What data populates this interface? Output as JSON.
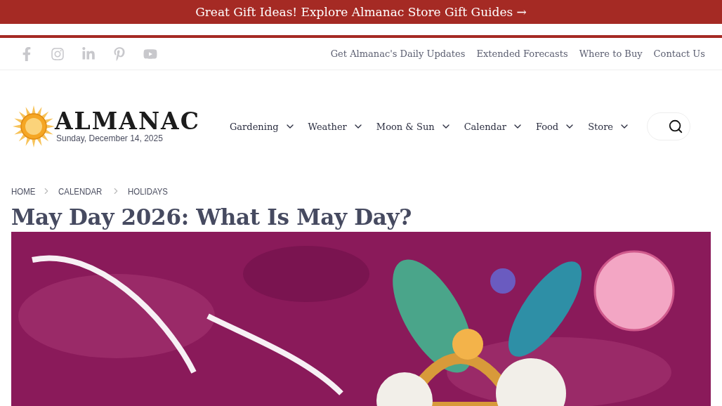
{
  "promo_banner": {
    "text": "Great Gift Ideas! Explore Almanac Store Gift Guides →"
  },
  "social_links": [
    {
      "kind": "facebook"
    },
    {
      "kind": "instagram"
    },
    {
      "kind": "linkedin"
    },
    {
      "kind": "pinterest"
    },
    {
      "kind": "youtube"
    }
  ],
  "utility_links": [
    "Get Almanac's Daily Updates",
    "Extended Forecasts",
    "Where to Buy",
    "Contact Us"
  ],
  "logo": {
    "wordmark": "ALMANAC",
    "date": "Sunday, December 14, 2025"
  },
  "main_nav": [
    "Gardening",
    "Weather",
    "Moon & Sun",
    "Calendar",
    "Food",
    "Store"
  ],
  "breadcrumb": [
    "HOME",
    "CALENDAR",
    "HOLIDAYS"
  ],
  "article": {
    "title": "May Day 2026: What Is May Day?"
  }
}
